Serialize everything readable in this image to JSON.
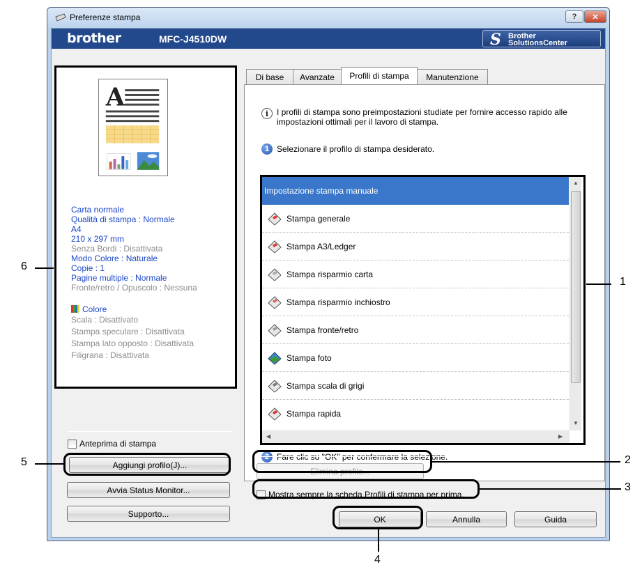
{
  "window": {
    "title": "Preferenze stampa",
    "help_label": "?",
    "close_label": "✕"
  },
  "brand": {
    "logo": "brother",
    "model": "MFC-J4510DW",
    "solutions_line1": "Brother",
    "solutions_line2": "SolutionsCenter"
  },
  "preview": {
    "settings": [
      {
        "text": "Carta normale",
        "style": "blue"
      },
      {
        "text": "Qualità di stampa : Normale",
        "style": "blue"
      },
      {
        "text": "A4",
        "style": "blue"
      },
      {
        "text": "210 x 297 mm",
        "style": "blue"
      },
      {
        "text": "Senza Bordi : Disattivata",
        "style": "grey"
      },
      {
        "text": "Modo Colore : Naturale",
        "style": "blue"
      },
      {
        "text": "Copie : 1",
        "style": "blue"
      },
      {
        "text": "Pagine multiple : Normale",
        "style": "blue"
      },
      {
        "text": "Fronte/retro / Opuscolo : Nessuna",
        "style": "grey"
      }
    ],
    "color_label": "Colore",
    "extra": [
      "Scala : Disattivato",
      "Stampa speculare : Disattivata",
      "Stampa lato opposto : Disattivata",
      "Filigrana : Disattivata"
    ]
  },
  "left_controls": {
    "preview_checkbox_label": "Anteprima di stampa",
    "add_profile": "Aggiungi profilo(J)...",
    "status_monitor": "Avvia Status Monitor...",
    "support": "Supporto..."
  },
  "tabs": [
    "Di base",
    "Avanzate",
    "Profili di stampa",
    "Manutenzione"
  ],
  "profiles": {
    "info_text": "I profili di stampa sono preimpostazioni studiate per fornire accesso rapido alle impostazioni ottimali per il lavoro di stampa.",
    "step1_num": "1",
    "step1_label": "Selezionare il profilo di stampa desiderato.",
    "items": [
      "Impostazione stampa manuale",
      "Stampa generale",
      "Stampa A3/Ledger",
      "Stampa risparmio carta",
      "Stampa risparmio inchiostro",
      "Stampa fronte/retro",
      "Stampa foto",
      "Stampa scala di grigi",
      "Stampa rapida"
    ],
    "selected_index": 0,
    "step2_num": "2",
    "step2_label": "Fare clic su \"OK\" per confermare la selezione.",
    "delete_profile": "Elimina profilo...",
    "always_show_label": "Mostra sempre la scheda Profili di stampa per prima."
  },
  "dialog_buttons": {
    "ok": "OK",
    "cancel": "Annulla",
    "help": "Guida"
  },
  "callouts": [
    "1",
    "2",
    "3",
    "4",
    "5",
    "6"
  ]
}
